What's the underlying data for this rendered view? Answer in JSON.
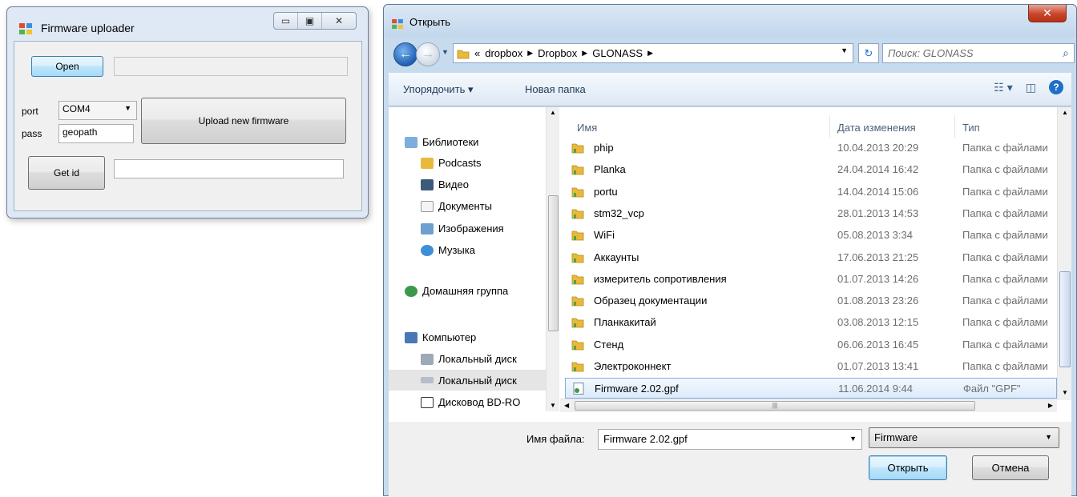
{
  "fw": {
    "title": "Firmware uploader",
    "open_button": "Open",
    "path_value": "",
    "port_label": "port",
    "port_value": "COM4",
    "pass_label": "pass",
    "pass_value": "geopath",
    "upload_button": "Upload new firmware",
    "getid_button": "Get id",
    "id_value": ""
  },
  "dialog": {
    "title": "Открыть",
    "breadcrumb_prefix": "«",
    "breadcrumbs": [
      "dropbox",
      "Dropbox",
      "GLONASS"
    ],
    "search_placeholder": "Поиск: GLONASS",
    "organize_label": "Упорядочить ▾",
    "new_folder_label": "Новая папка",
    "nav": [
      {
        "label": "Библиотеки",
        "icon": "libraries-icon"
      },
      {
        "label": "Podcasts",
        "icon": "folder-icon"
      },
      {
        "label": "Видео",
        "icon": "video-icon"
      },
      {
        "label": "Документы",
        "icon": "documents-icon"
      },
      {
        "label": "Изображения",
        "icon": "pictures-icon"
      },
      {
        "label": "Музыка",
        "icon": "music-icon"
      },
      {
        "label": "Домашняя группа",
        "icon": "homegroup-icon"
      },
      {
        "label": "Компьютер",
        "icon": "computer-icon"
      },
      {
        "label": "Локальный диск",
        "icon": "drive-icon"
      },
      {
        "label": "Локальный диск",
        "icon": "drive-icon"
      },
      {
        "label": "Дисковод BD-RO",
        "icon": "optical-drive-icon"
      }
    ],
    "columns": {
      "name": "Имя",
      "date": "Дата изменения",
      "type": "Тип"
    },
    "files": [
      {
        "name": "phip",
        "date": "10.04.2013 20:29",
        "type": "Папка с файлами"
      },
      {
        "name": "Planka",
        "date": "24.04.2014 16:42",
        "type": "Папка с файлами"
      },
      {
        "name": "portu",
        "date": "14.04.2014 15:06",
        "type": "Папка с файлами"
      },
      {
        "name": "stm32_vcp",
        "date": "28.01.2013 14:53",
        "type": "Папка с файлами"
      },
      {
        "name": "WiFi",
        "date": "05.08.2013 3:34",
        "type": "Папка с файлами"
      },
      {
        "name": "Аккаунты",
        "date": "17.06.2013 21:25",
        "type": "Папка с файлами"
      },
      {
        "name": "измеритель сопротивления",
        "date": "01.07.2013 14:26",
        "type": "Папка с файлами"
      },
      {
        "name": "Образец документации",
        "date": "01.08.2013 23:26",
        "type": "Папка с файлами"
      },
      {
        "name": "Планкакитай",
        "date": "03.08.2013 12:15",
        "type": "Папка с файлами"
      },
      {
        "name": "Стенд",
        "date": "06.06.2013 16:45",
        "type": "Папка с файлами"
      },
      {
        "name": "Электроконнект",
        "date": "01.07.2013 13:41",
        "type": "Папка с файлами"
      },
      {
        "name": "Firmware 2.02.gpf",
        "date": "11.06.2014 9:44",
        "type": "Файл \"GPF\""
      }
    ],
    "filename_label": "Имя файла:",
    "filename_value": "Firmware 2.02.gpf",
    "filetype_value": "Firmware",
    "open_button": "Открыть",
    "cancel_button": "Отмена"
  },
  "colors": {
    "folder": "#e8b93a",
    "selection": "#dcebfb",
    "accent": "#1f6fc7"
  }
}
